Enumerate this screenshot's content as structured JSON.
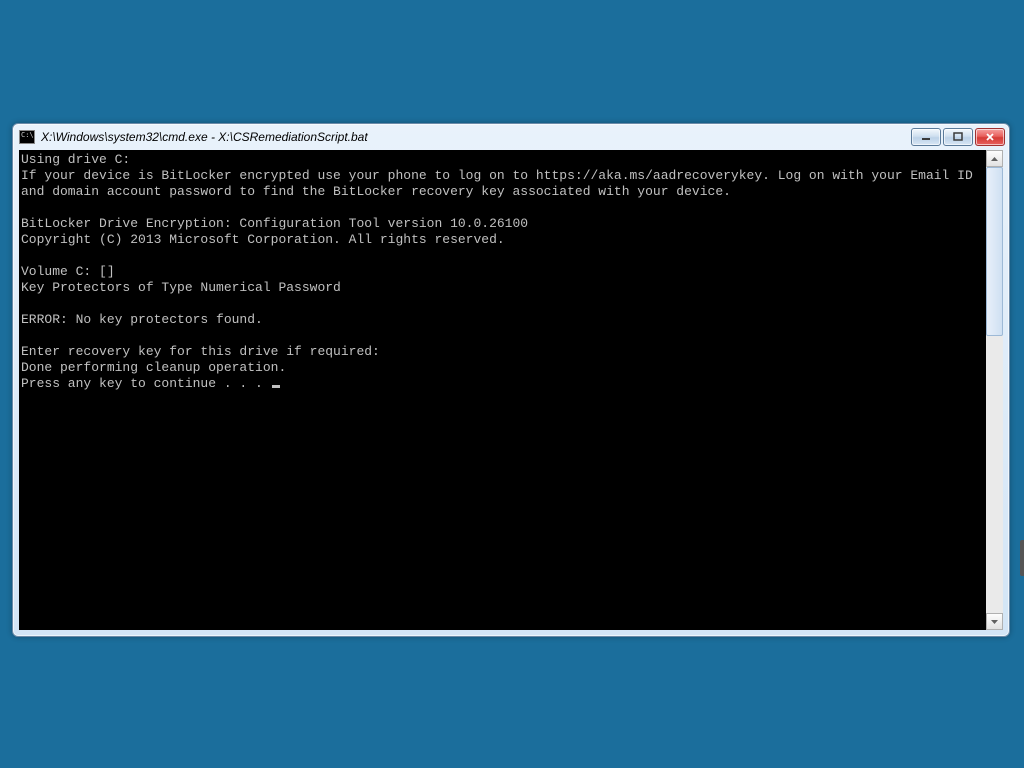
{
  "window": {
    "title": "X:\\Windows\\system32\\cmd.exe - X:\\CSRemediationScript.bat"
  },
  "console": {
    "lines": [
      "Using drive C:",
      "If your device is BitLocker encrypted use your phone to log on to https://aka.ms/aadrecoverykey. Log on with your Email ID and domain account password to find the BitLocker recovery key associated with your device.",
      "",
      "BitLocker Drive Encryption: Configuration Tool version 10.0.26100",
      "Copyright (C) 2013 Microsoft Corporation. All rights reserved.",
      "",
      "Volume C: []",
      "Key Protectors of Type Numerical Password",
      "",
      "ERROR: No key protectors found.",
      "",
      "Enter recovery key for this drive if required:",
      "Done performing cleanup operation.",
      "Press any key to continue . . . "
    ]
  }
}
